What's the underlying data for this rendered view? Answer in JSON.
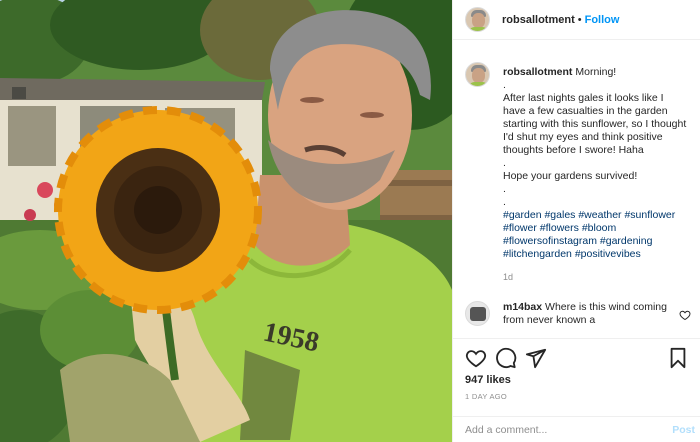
{
  "post": {
    "username": "robsallotment",
    "separator": "•",
    "follow_label": "Follow",
    "image_icon": "photo-sunflower-portrait",
    "print_text": "1958"
  },
  "caption": {
    "username": "robsallotment",
    "first": "Morning!",
    "dot1": ".",
    "body": "After last nights gales it looks like I have a few casualties in the garden starting with this sunflower, so I thought I'd shut my eyes and think positive thoughts before I swore! Haha",
    "dot2": ".",
    "line2": "Hope your gardens survived!",
    "dot3": ".",
    "dot4": ".",
    "hashtags": [
      "#garden",
      "#gales",
      "#weather",
      "#sunflower",
      "#flower",
      "#flowers",
      "#bloom",
      "#flowersofinstagram",
      "#gardening",
      "#litchengarden",
      "#positivevibes"
    ],
    "age": "1d"
  },
  "comments": [
    {
      "username": "m14bax",
      "text": "Where is this wind coming from never known a"
    }
  ],
  "actions": {
    "icons": [
      "heart-icon",
      "comment-icon",
      "share-icon",
      "bookmark-icon"
    ],
    "likes": "947 likes",
    "time_ago": "1 DAY AGO"
  },
  "add_comment": {
    "placeholder": "Add a comment...",
    "post_label": "Post"
  },
  "colors": {
    "link": "#0095f6",
    "hashtag": "#00376b",
    "muted": "#8e8e8e",
    "post_disabled": "#b2dffc",
    "shirt": "#a4d04b",
    "petal": "#f2a516"
  }
}
